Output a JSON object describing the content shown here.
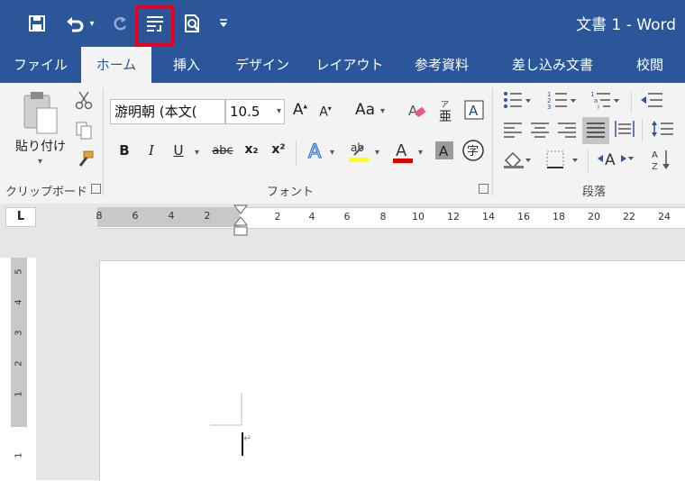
{
  "app": {
    "title": "文書 1 - Word"
  },
  "quick_access": {
    "save": "save-icon",
    "undo": "undo-icon",
    "redo": "redo-icon",
    "paragraph_marks": "show-hide-marks-icon",
    "print_preview": "print-preview-icon",
    "customize": "customize-qat-icon"
  },
  "tabs": [
    {
      "label": "ファイル"
    },
    {
      "label": "ホーム"
    },
    {
      "label": "挿入"
    },
    {
      "label": "デザイン"
    },
    {
      "label": "レイアウト"
    },
    {
      "label": "参考資料"
    },
    {
      "label": "差し込み文書"
    },
    {
      "label": "校閲"
    }
  ],
  "ribbon": {
    "clipboard": {
      "paste_label": "貼り付け",
      "group_label": "クリップボード"
    },
    "font": {
      "font_name": "游明朝 (本文(",
      "font_size": "10.5",
      "change_case": "Aa",
      "bold": "B",
      "italic": "I",
      "underline": "U",
      "strike": "abc",
      "subscript": "x₂",
      "superscript": "x²",
      "group_label": "フォント"
    },
    "paragraph": {
      "group_label": "段落"
    }
  },
  "ruler": {
    "corner": "L",
    "left_ticks": [
      "8",
      "6",
      "4",
      "2"
    ],
    "right_ticks": [
      "2",
      "4",
      "6",
      "8",
      "10",
      "12",
      "14",
      "16",
      "18",
      "20",
      "22",
      "24"
    ],
    "vertical_ticks": [
      "5",
      "4",
      "3",
      "2",
      "1",
      "1"
    ]
  },
  "colors": {
    "accent": "#2b579a",
    "highlight": "#e8001c"
  }
}
